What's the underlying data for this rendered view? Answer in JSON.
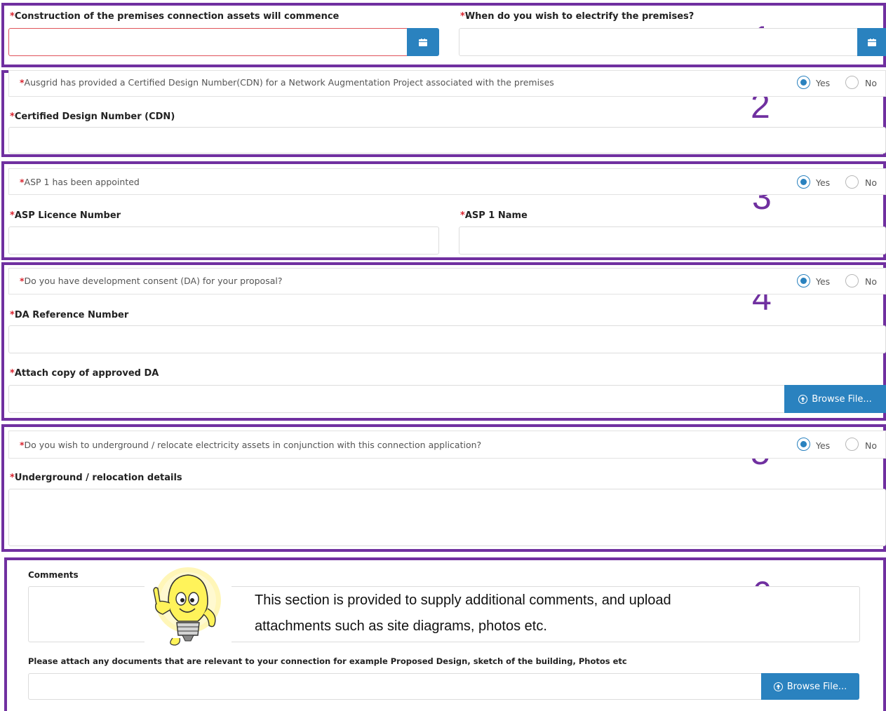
{
  "section1": {
    "number": "1",
    "construction_label": "Construction of the premises connection assets will commence",
    "electrify_label": "When do you wish to electrify the premises?",
    "calendar_icon": "calendar-icon"
  },
  "section2": {
    "number": "2",
    "question": "Ausgrid has provided a Certified Design Number(CDN) for a Network Augmentation Project associated with the premises",
    "yes": "Yes",
    "no": "No",
    "cdn_label": "Certified Design Number (CDN)"
  },
  "section3": {
    "number": "3",
    "question": "ASP 1 has been appointed",
    "yes": "Yes",
    "no": "No",
    "licence_label": "ASP Licence Number",
    "name_label": "ASP 1 Name"
  },
  "section4": {
    "number": "4",
    "question": "Do you have development consent (DA) for your proposal?",
    "yes": "Yes",
    "no": "No",
    "da_ref_label": "DA Reference Number",
    "attach_label": "Attach copy of approved DA",
    "browse_label": "Browse File..."
  },
  "section5": {
    "number": "5",
    "question": "Do you wish to underground / relocate electricity assets in conjunction with this connection application?",
    "yes": "Yes",
    "no": "No",
    "details_label": "Underground / relocation details"
  },
  "section6": {
    "number": "6",
    "comments_label": "Comments",
    "tip_line1": "This section is provided to supply additional comments, and upload",
    "tip_line2": "attachments such as site diagrams, photos etc.",
    "attach_label": "Please attach any documents that are relevant to your connection for example Proposed Design, sketch of the building, Photos etc",
    "browse_label": "Browse File..."
  },
  "required_marker": "*",
  "colors": {
    "accent": "#2a82bf",
    "annotation": "#7030a0",
    "required": "#d9232e"
  }
}
